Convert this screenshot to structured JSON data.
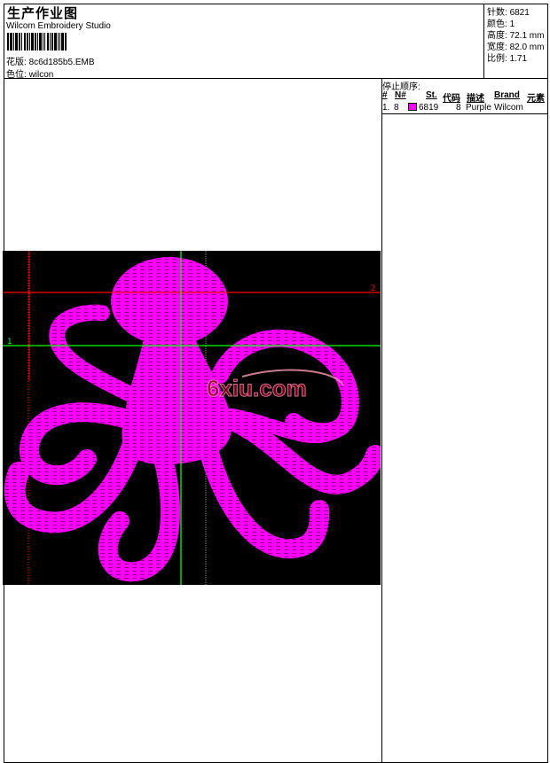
{
  "header": {
    "title": "生产作业图",
    "software": "Wilcom Embroidery Studio",
    "design_label": "花版:",
    "design_value": "8c6d185b5.EMB",
    "colorway_label": "色位:",
    "colorway_value": "wilcon"
  },
  "stats": {
    "stitches_label": "针数:",
    "stitches_value": "6821",
    "colors_label": "颜色:",
    "colors_value": "1",
    "height_label": "高度:",
    "height_value": "72.1 mm",
    "width_label": "宽度:",
    "width_value": "82.0 mm",
    "ratio_label": "比例:",
    "ratio_value": "1.71"
  },
  "stop_sequence": {
    "title": "停止顺序:",
    "columns": [
      "#",
      "N#",
      "St.",
      "代码",
      "描述",
      "Brand",
      "元素"
    ],
    "rows": [
      {
        "index": "1.",
        "needle": "8",
        "color": "#ff00ff",
        "stitches": "6819",
        "code": "8",
        "description": "Purple",
        "brand": "Wilcom"
      }
    ]
  },
  "design": {
    "thread_color": "#ff00ff",
    "background": "#000000",
    "guide_labels": {
      "green": "1",
      "red": "2"
    },
    "watermark": "6xiu.com"
  }
}
